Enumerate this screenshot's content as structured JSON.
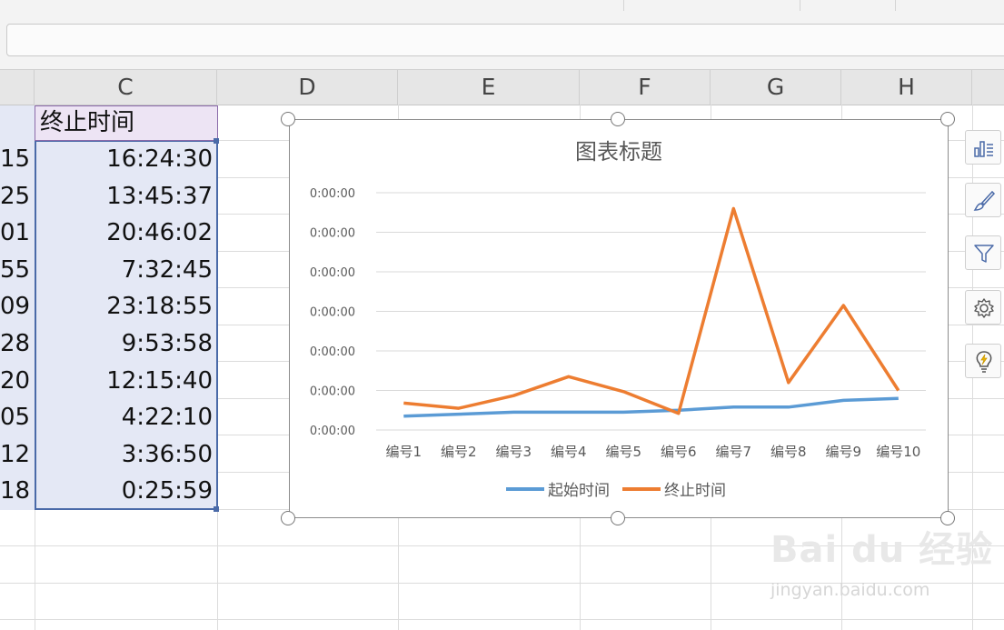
{
  "columns": [
    "C",
    "D",
    "E",
    "F",
    "G",
    "H"
  ],
  "sheet": {
    "header_c": "终止时间",
    "col_b_partial": [
      "15",
      "25",
      "01",
      "55",
      "09",
      "28",
      "20",
      "05",
      "12",
      "18"
    ],
    "col_c_values": [
      "16:24:30",
      "13:45:37",
      "20:46:02",
      "7:32:45",
      "23:18:55",
      "9:53:58",
      "12:15:40",
      "4:22:10",
      "3:36:50",
      "0:25:59"
    ]
  },
  "chart_data": {
    "type": "line",
    "title": "图表标题",
    "categories": [
      "编号1",
      "编号2",
      "编号3",
      "编号4",
      "编号5",
      "编号6",
      "编号7",
      "编号8",
      "编号9",
      "编号10"
    ],
    "y_tick_labels": [
      "0:00:00",
      "0:00:00",
      "0:00:00",
      "0:00:00",
      "0:00:00",
      "0:00:00",
      "0:00:00"
    ],
    "ylim": [
      0,
      6
    ],
    "series": [
      {
        "name": "起始时间",
        "color": "#5b9bd5",
        "values": [
          0.35,
          0.4,
          0.45,
          0.45,
          0.45,
          0.5,
          0.58,
          0.58,
          0.75,
          0.8
        ]
      },
      {
        "name": "终止时间",
        "color": "#ed7d31",
        "values": [
          0.68,
          0.55,
          0.87,
          1.35,
          0.97,
          0.42,
          5.6,
          1.2,
          3.15,
          1.0
        ]
      }
    ],
    "legend_position": "bottom",
    "grid": true
  },
  "side_buttons": [
    {
      "name": "chart-elements-icon"
    },
    {
      "name": "chart-style-icon"
    },
    {
      "name": "chart-filter-icon"
    },
    {
      "name": "chart-settings-icon"
    },
    {
      "name": "chart-quick-analysis-icon"
    }
  ],
  "watermark": {
    "logo": "Bai du 经验",
    "url": "jingyan.baidu.com"
  }
}
